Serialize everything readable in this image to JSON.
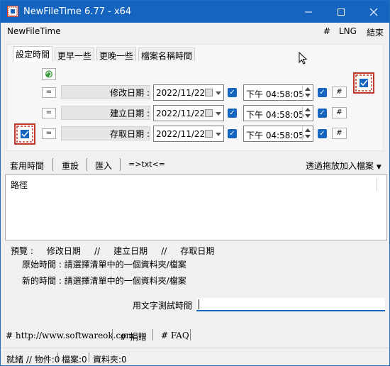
{
  "window": {
    "title": "NewFileTime 6.77 - x64",
    "accent": "#1565c0"
  },
  "menubar": {
    "app_name": "NewFileTime",
    "hash": "#",
    "lng": "LNG",
    "exit": "結束"
  },
  "tabs": [
    {
      "label": "設定時間",
      "active": true
    },
    {
      "label": "更早一些",
      "active": false
    },
    {
      "label": "更晚一些",
      "active": false
    },
    {
      "label": "檔案名稱時間",
      "active": false
    }
  ],
  "rows": [
    {
      "eq": "=",
      "label": "修改日期 :",
      "date": "2022/11/22",
      "time": "下午 04:58:05",
      "hash": "#",
      "checked": true
    },
    {
      "eq": "=",
      "label": "建立日期 :",
      "date": "2022/11/22",
      "time": "下午 04:58:05",
      "hash": "#",
      "checked": true
    },
    {
      "eq": "=",
      "label": "存取日期 :",
      "date": "2022/11/22",
      "time": "下午 04:58:05",
      "hash": "#",
      "checked": true
    }
  ],
  "toolbar": {
    "apply": "套用時間",
    "reset": "重設",
    "import": "匯入",
    "txt": "=>txt<=",
    "drag_add": "透過拖放加入檔案"
  },
  "list": {
    "header_path": "路徑"
  },
  "preview": {
    "title": "預覽 :     修改日期     //     建立日期     //     存取日期",
    "original": "原始時間 : 請選擇清單中的一個資料夾/檔案",
    "new": "新的時間 : 請選擇清單中的一個資料夾/檔案"
  },
  "text_test": {
    "label": "用文字測試時間",
    "value": ""
  },
  "footer": {
    "website": "# http://www.softwareok.com",
    "donate": "# 捐贈",
    "faq": "# FAQ"
  },
  "status": {
    "ready": "就緒 // 物件:0",
    "files": "檔案:0",
    "folders": "資料夾:0"
  },
  "icons": [
    "app-icon",
    "minimize-icon",
    "maximize-icon",
    "close-icon",
    "refresh-icon",
    "file-time-icon",
    "calendar-icon",
    "dropdown-icon",
    "spin-up-icon",
    "spin-down-icon",
    "checkbox-checked-icon"
  ]
}
